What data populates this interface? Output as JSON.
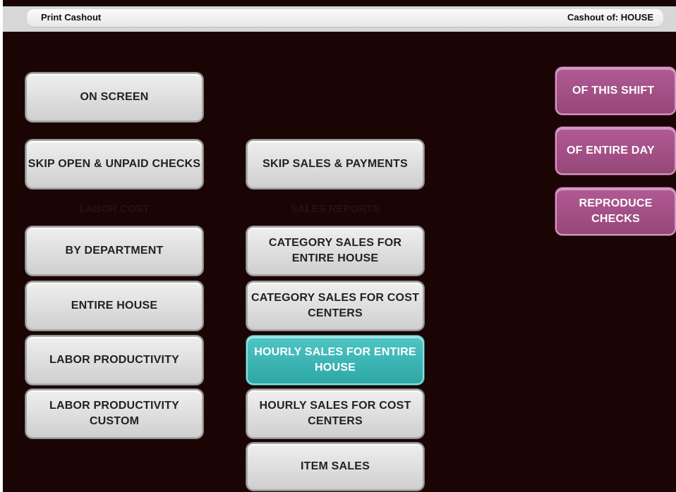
{
  "header": {
    "title": "Print Cashout",
    "cashout_of": "Cashout of: HOUSE"
  },
  "left_column": {
    "on_screen": "ON SCREEN",
    "skip_open_unpaid": "SKIP OPEN & UNPAID CHECKS",
    "section_label": "LABOR COST",
    "by_department": "BY DEPARTMENT",
    "entire_house": "ENTIRE HOUSE",
    "labor_productivity": "LABOR PRODUCTIVITY",
    "labor_productivity_custom": "LABOR PRODUCTIVITY CUSTOM"
  },
  "middle_column": {
    "skip_sales_payments": "SKIP SALES & PAYMENTS",
    "section_label": "SALES REPORTS",
    "category_sales_entire_house": "CATEGORY SALES FOR ENTIRE HOUSE",
    "category_sales_cost_centers": "CATEGORY SALES FOR COST CENTERS",
    "hourly_sales_entire_house": "HOURLY SALES FOR ENTIRE HOUSE",
    "hourly_sales_cost_centers": "HOURLY SALES FOR COST CENTERS",
    "item_sales": "ITEM SALES"
  },
  "right_column": {
    "of_this_shift": "OF THIS SHIFT",
    "of_entire_day": "OF ENTIRE DAY",
    "reproduce_checks": "REPRODUCE CHECKS"
  },
  "colors": {
    "background": "#1b0404",
    "button_gray": "#dcdcdc",
    "button_selected_teal": "#3db6b5",
    "button_purple": "#a4508a"
  }
}
